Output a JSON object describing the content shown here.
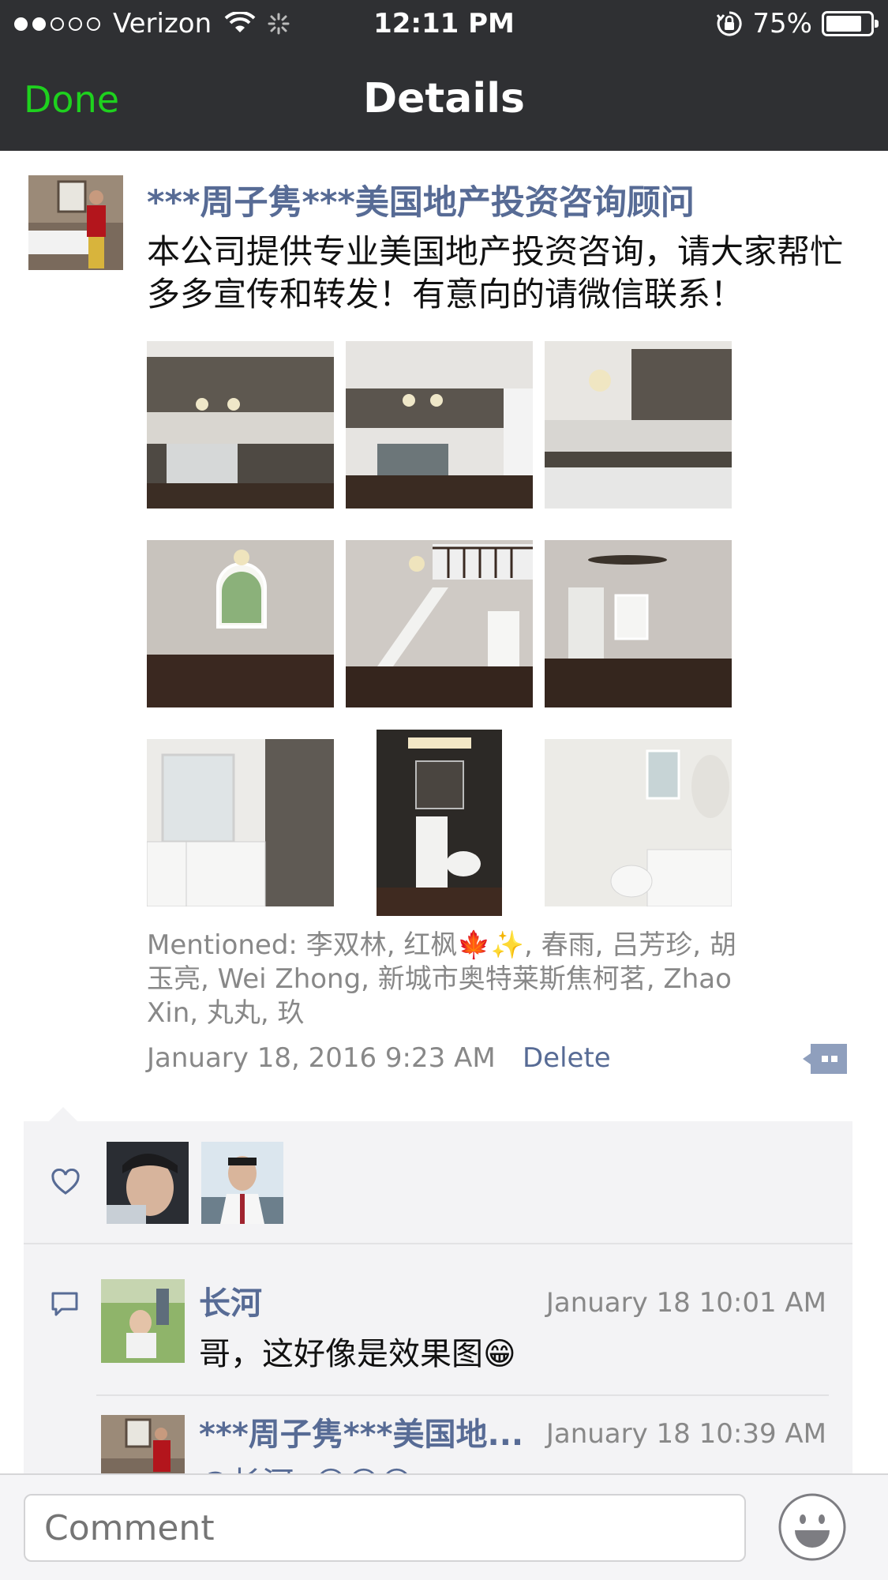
{
  "status_bar": {
    "carrier": "Verizon",
    "time": "12:11 PM",
    "battery": "75%",
    "battery_level": 0.75,
    "signal_bars": 2
  },
  "nav": {
    "done_label": "Done",
    "title": "Details"
  },
  "post": {
    "author": "***周子隽***美国地产投资咨询顾问",
    "text": "本公司提供专业美国地产投资咨询，请大家帮忙多多宣传和转发！有意向的请微信联系！",
    "photos": [
      "kitchen-photo-1",
      "kitchen-photo-2",
      "kitchen-photo-3",
      "living-room-photo",
      "staircase-photo",
      "bedroom-photo",
      "bathroom-photo-1",
      "powder-room-photo",
      "bathroom-photo-2"
    ],
    "mentioned_prefix": "Mentioned: ",
    "mentioned_names": "李双林, 红枫🍁✨, 春雨, 吕芳珍, 胡玉亮, Wei Zhong, 新城市奥特莱斯焦柯茗, Zhao Xin, 丸丸, 玖",
    "timestamp": "January 18, 2016 9:23 AM",
    "delete_label": "Delete"
  },
  "likes": {
    "icon": "heart-icon",
    "likers": [
      "liker-1",
      "liker-2"
    ]
  },
  "comments": [
    {
      "name": "长河",
      "time": "January 18 10:01 AM",
      "text": "哥，这好像是效果图😁"
    },
    {
      "name": "***周子隽***美国地...",
      "time": "January 18 10:39 AM",
      "text": "@长河: 😁😁😁"
    }
  ],
  "composer": {
    "placeholder": "Comment",
    "emoji_icon": "smiley-face-icon"
  },
  "colors": {
    "nav_bg": "#2f3033",
    "done_green": "#1ed11e",
    "link_blue": "#576b95",
    "panel_bg": "#f3f3f5"
  }
}
